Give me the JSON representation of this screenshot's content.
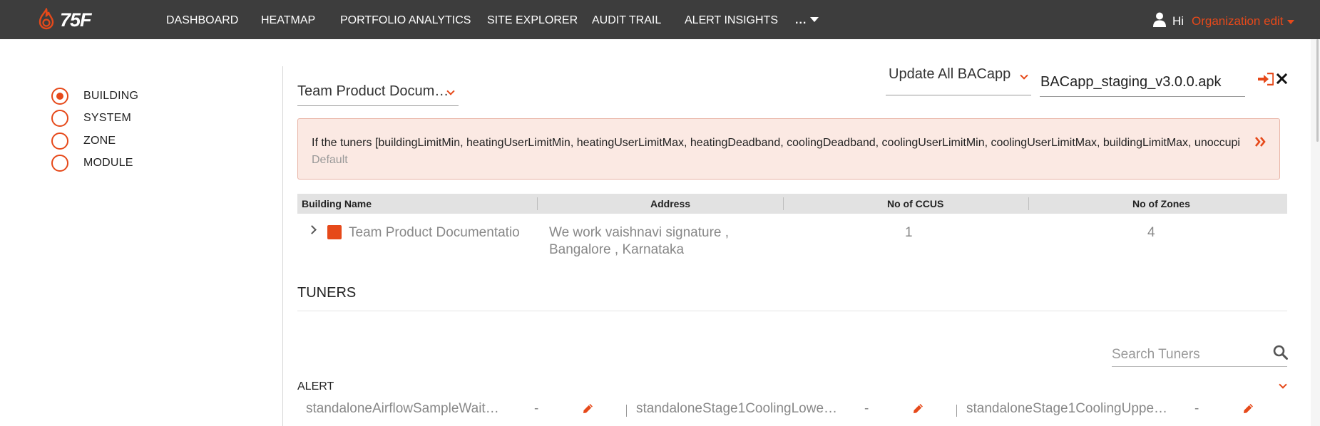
{
  "brand": {
    "logo_text": "75F",
    "accent": "#e6491a",
    "nav_bg": "#3d3d3d"
  },
  "nav": {
    "items": [
      {
        "label": "DASHBOARD"
      },
      {
        "label": "HEATMAP"
      },
      {
        "label": "PORTFOLIO ANALYTICS"
      },
      {
        "label": "SITE EXPLORER"
      },
      {
        "label": "AUDIT TRAIL"
      },
      {
        "label": "ALERT INSIGHTS"
      }
    ],
    "more_label": "..."
  },
  "user": {
    "greeting": "Hi",
    "org": "Organization edit",
    "icon": "user-icon"
  },
  "sidebar": {
    "options": [
      {
        "label": "BUILDING",
        "selected": true
      },
      {
        "label": "SYSTEM",
        "selected": false
      },
      {
        "label": "ZONE",
        "selected": false
      },
      {
        "label": "MODULE",
        "selected": false
      }
    ]
  },
  "site_selector": {
    "value": "Team Product Docum…"
  },
  "update": {
    "select_value": "Update All BACapp",
    "apk_value": "BACapp_staging_v3.0.0.apk"
  },
  "warning": {
    "text": "If the tuners [buildingLimitMin, heatingUserLimitMin, heatingUserLimitMax, heatingDeadband, coolingDeadband, coolingUserLimitMin, coolingUserLimitMax, buildingLimitMax, unoccupi",
    "sub": "Default"
  },
  "table": {
    "headers": [
      "Building Name",
      "Address",
      "No of CCUS",
      "No of Zones"
    ],
    "row": {
      "building": "Team Product Documentatio",
      "address_line1": "We work vaishnavi signature ,",
      "address_line2": "Bangalore , Karnataka",
      "ccus": "1",
      "zones": "4"
    }
  },
  "tuners": {
    "title": "TUNERS",
    "search_placeholder": "Search Tuners",
    "group": "ALERT",
    "items": [
      {
        "name": "standaloneAirflowSampleWait…",
        "value": "-"
      },
      {
        "name": "standaloneStage1CoolingLowe…",
        "value": "-"
      },
      {
        "name": "standaloneStage1CoolingUppe…",
        "value": "-"
      }
    ]
  }
}
